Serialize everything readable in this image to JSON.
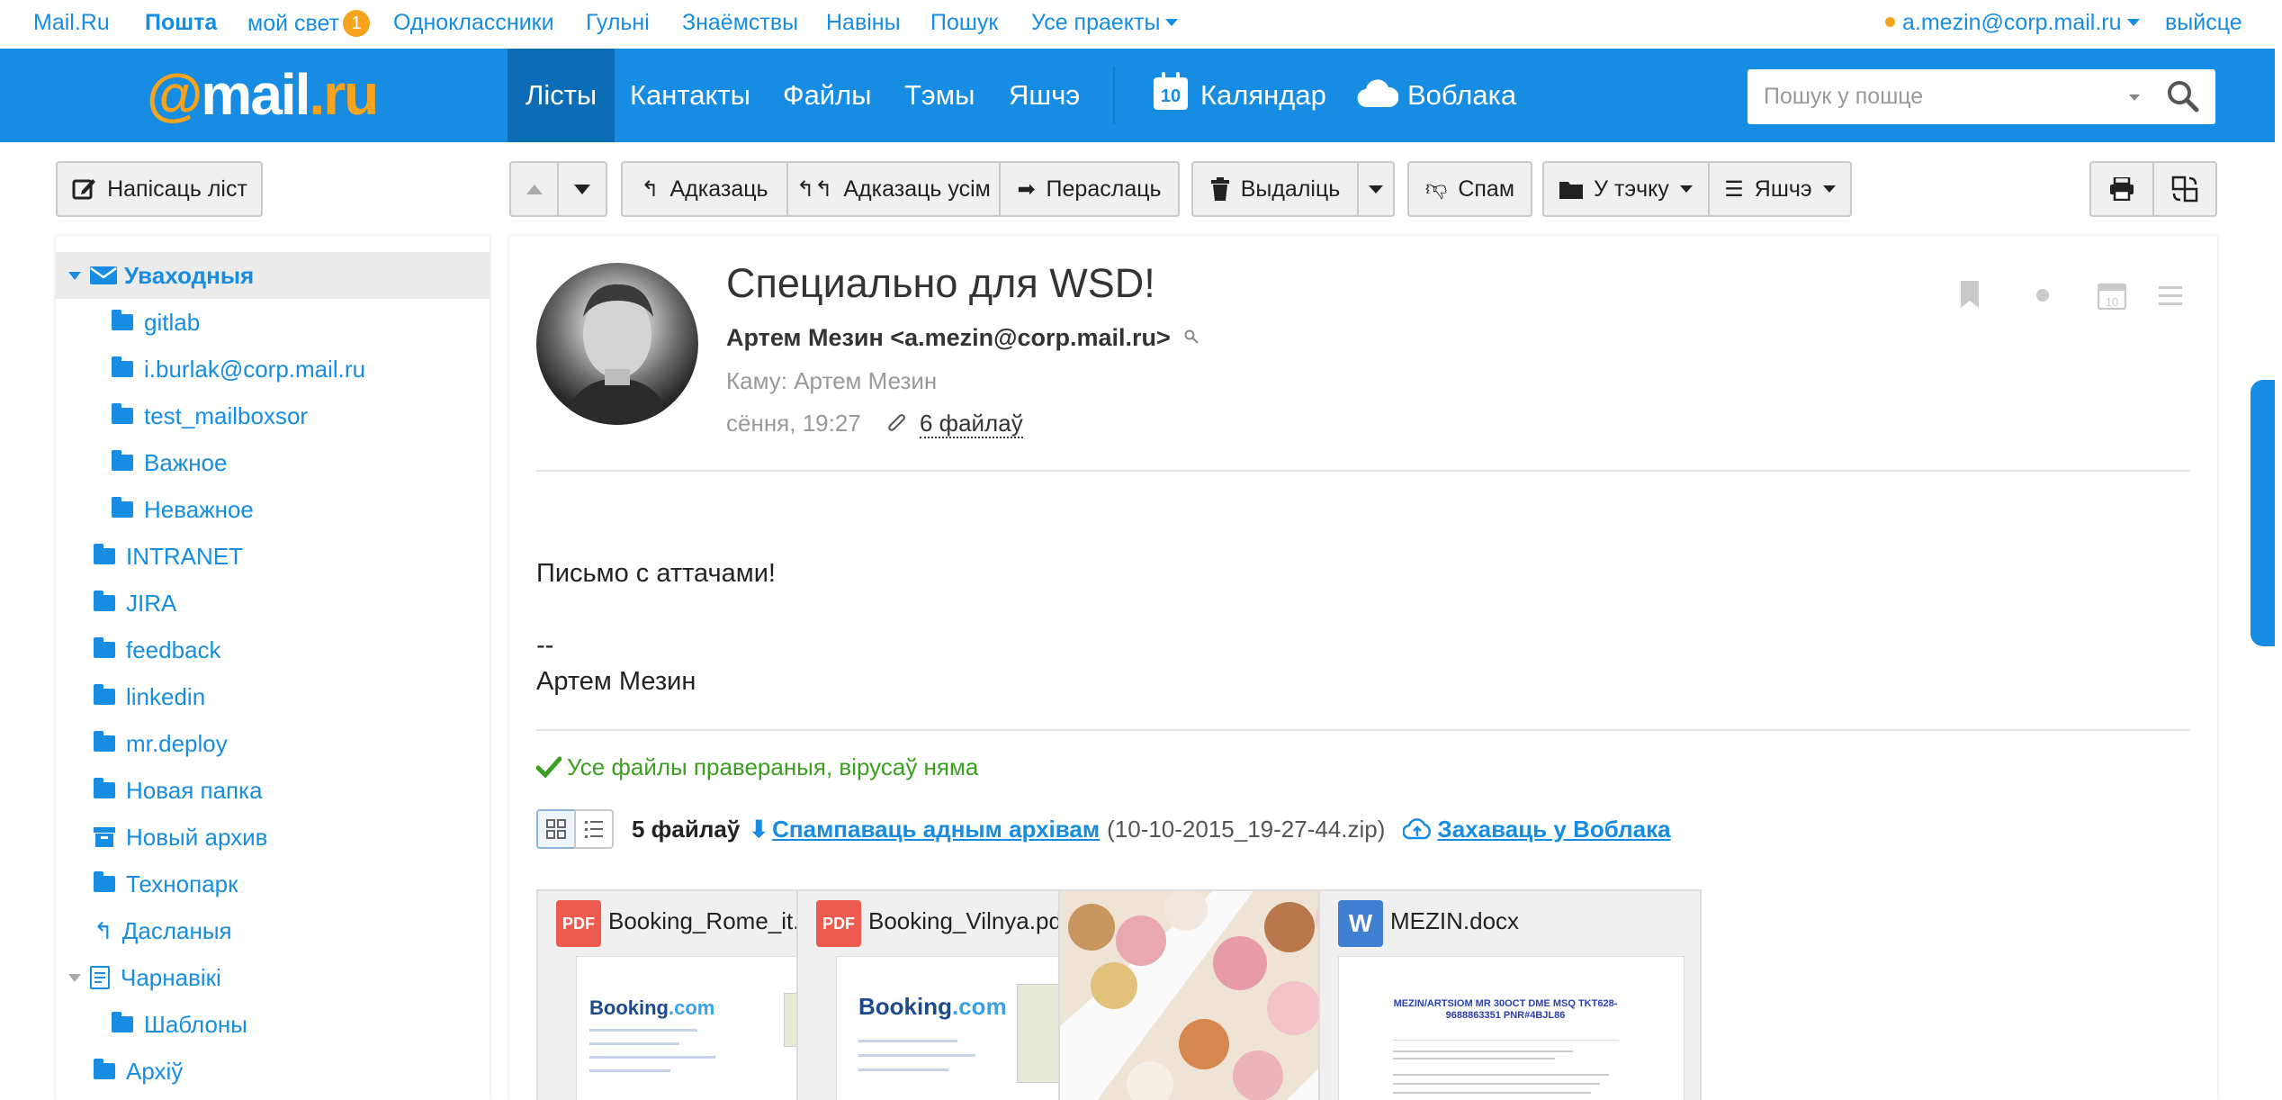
{
  "portal": {
    "links": [
      {
        "label": "Mail.Ru"
      },
      {
        "label": "Пошта"
      },
      {
        "label": "мой свет",
        "badge": "1"
      },
      {
        "label": "Одноклассники"
      },
      {
        "label": "Гульні"
      },
      {
        "label": "Знаёмствы"
      },
      {
        "label": "Навіны"
      },
      {
        "label": "Пошук"
      },
      {
        "label": "Усе праекты"
      }
    ],
    "account": "a.mezin@corp.mail.ru",
    "logout": "выйсце"
  },
  "header": {
    "logo": {
      "at": "@",
      "mail": "mail",
      "dot": ".",
      "ru": "ru"
    },
    "nav": [
      "Лісты",
      "Кантакты",
      "Файлы",
      "Тэмы",
      "Яшчэ"
    ],
    "calendar": {
      "label": "Каляндар",
      "day": "10"
    },
    "cloud": "Воблака",
    "search_placeholder": "Пошук у пошце"
  },
  "toolbar": {
    "compose": "Напісаць ліст",
    "reply": "Адказаць",
    "reply_all": "Адказаць усім",
    "forward": "Пераслаць",
    "delete": "Выдаліць",
    "spam": "Спам",
    "to_folder": "У тэчку",
    "more": "Яшчэ"
  },
  "folders": [
    {
      "label": "Уваходныя"
    },
    {
      "label": "gitlab"
    },
    {
      "label": "i.burlak@corp.mail.ru"
    },
    {
      "label": "test_mailboxsor"
    },
    {
      "label": "Важное"
    },
    {
      "label": "Неважное"
    },
    {
      "label": "INTRANET"
    },
    {
      "label": "JIRA"
    },
    {
      "label": "feedback"
    },
    {
      "label": "linkedin"
    },
    {
      "label": "mr.deploy"
    },
    {
      "label": "Новая папка"
    },
    {
      "label": "Новый архив"
    },
    {
      "label": "Технопарк"
    },
    {
      "label": "Дасланыя"
    },
    {
      "label": "Чарнавікі"
    },
    {
      "label": "Шаблоны"
    },
    {
      "label": "Архіў"
    }
  ],
  "message": {
    "subject": "Специально для WSD!",
    "from": "Артем Мезин <a.mezin@corp.mail.ru>",
    "to": "Каму: Артем Мезин",
    "date": "сёння, 19:27",
    "files_count": "6 файлаў",
    "body": "Письмо с аттачами!\n\n--\nАртем Мезин",
    "virus_check": "Усе файлы правераныя, вірусаў няма",
    "attach_count": "5 файлаў",
    "download_archive": "Спампаваць адным архівам",
    "archive_name": "(10-10-2015_19-27-44.zip)",
    "save_cloud": "Захаваць у Воблака",
    "attachments": [
      {
        "name": "Booking_Rome_it.pdf",
        "type": "PDF"
      },
      {
        "name": "Booking_Vilnya.pdf",
        "type": "PDF"
      },
      {
        "name": "",
        "type": "image"
      },
      {
        "name": "MEZIN.docx",
        "type": "W"
      }
    ],
    "booking_logo": {
      "a": "Booking",
      "b": ".com"
    },
    "docx_preview": "MEZIN/ARTSIOM MR 30OCT DME MSQ TKT628-9688863351 PNR#4BJL86"
  },
  "colors": {
    "accent": "#168de2",
    "logo": "#f7a31c",
    "success": "#3c9e22"
  }
}
